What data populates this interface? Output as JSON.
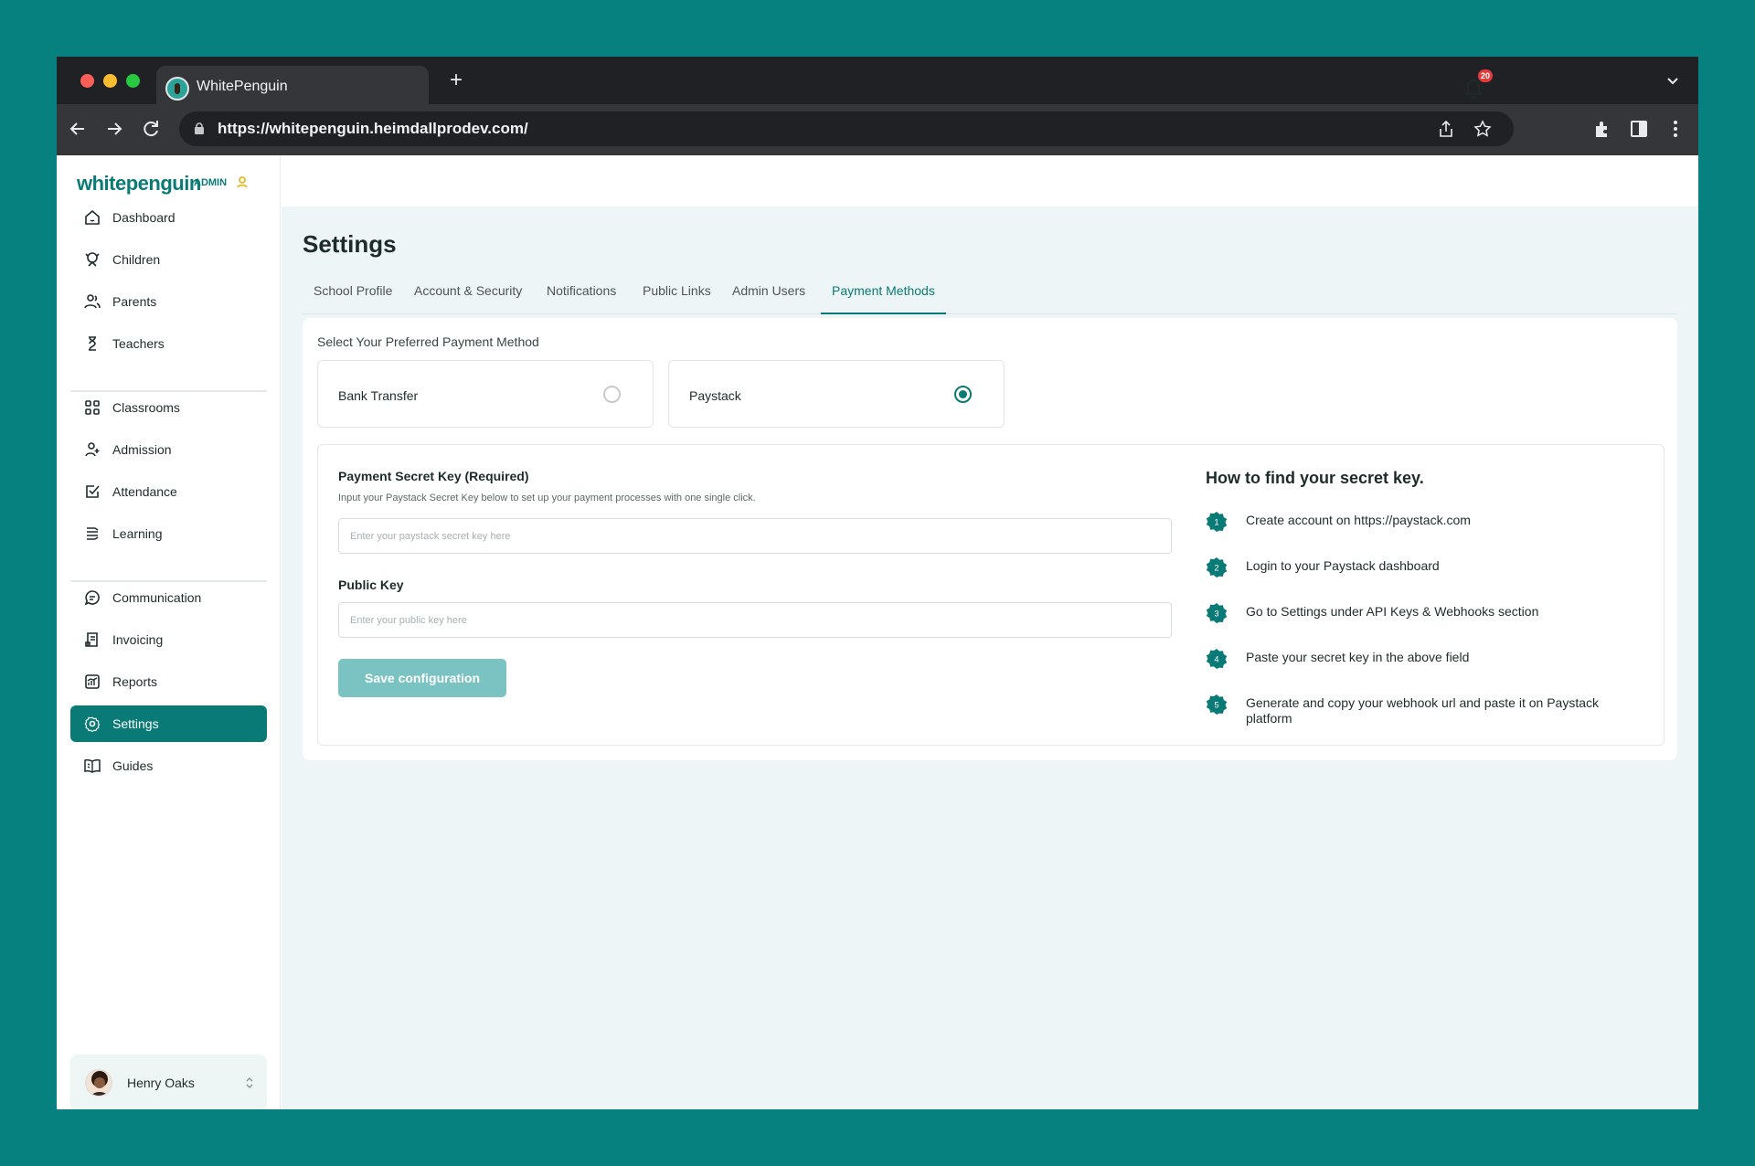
{
  "browser": {
    "tab_title": "WhitePenguin",
    "new_tab": "+",
    "url": "https://whitepenguin.heimdallprodev.com/"
  },
  "brand": {
    "logo": "whitepenguin",
    "badge": "ADMIN"
  },
  "sidebar": {
    "items": [
      {
        "label": "Dashboard",
        "icon": "home-icon"
      },
      {
        "label": "Children",
        "icon": "child-icon"
      },
      {
        "label": "Parents",
        "icon": "users-icon"
      },
      {
        "label": "Teachers",
        "icon": "teacher-icon"
      },
      {
        "label": "Classrooms",
        "icon": "grid-icon"
      },
      {
        "label": "Admission",
        "icon": "user-add-icon"
      },
      {
        "label": "Attendance",
        "icon": "checkbox-icon"
      },
      {
        "label": "Learning",
        "icon": "book-icon"
      },
      {
        "label": "Communication",
        "icon": "chat-icon"
      },
      {
        "label": "Invoicing",
        "icon": "invoice-icon"
      },
      {
        "label": "Reports",
        "icon": "chart-icon"
      },
      {
        "label": "Settings",
        "icon": "gear-icon",
        "active": true
      },
      {
        "label": "Guides",
        "icon": "open-book-icon"
      }
    ],
    "user": {
      "name": "Henry Oaks"
    }
  },
  "notifications": {
    "count": "20"
  },
  "settings": {
    "title": "Settings",
    "tabs": [
      "School Profile",
      "Account & Security",
      "Notifications",
      "Public Links",
      "Admin Users",
      "Payment Methods"
    ],
    "active_tab": "Payment Methods",
    "method_prompt": "Select Your Preferred Payment Method",
    "methods": [
      {
        "label": "Bank Transfer",
        "selected": false
      },
      {
        "label": "Paystack",
        "selected": true
      }
    ],
    "form": {
      "secret_label": "Payment Secret Key (Required)",
      "secret_help": "Input your Paystack Secret Key below to set up your payment processes with one single click.",
      "secret_placeholder": "Enter your paystack secret key here",
      "public_label": "Public Key",
      "public_placeholder": "Enter your public key here",
      "save_label": "Save configuration"
    },
    "guide": {
      "title": "How to find your secret key.",
      "steps": [
        {
          "num": "1",
          "text": "Create account on https://paystack.com"
        },
        {
          "num": "2",
          "text": "Login to your Paystack dashboard"
        },
        {
          "num": "3",
          "text": "Go to Settings under API Keys & Webhooks section"
        },
        {
          "num": "4",
          "text": "Paste your secret key in the above field"
        },
        {
          "num": "5",
          "text": "Generate and copy your webhook url and paste it on Paystack platform"
        }
      ]
    }
  },
  "colors": {
    "background": "#078080",
    "accent": "#0a7a76",
    "button_disabled": "#7bc2c2",
    "badge": "#e23b3b"
  }
}
